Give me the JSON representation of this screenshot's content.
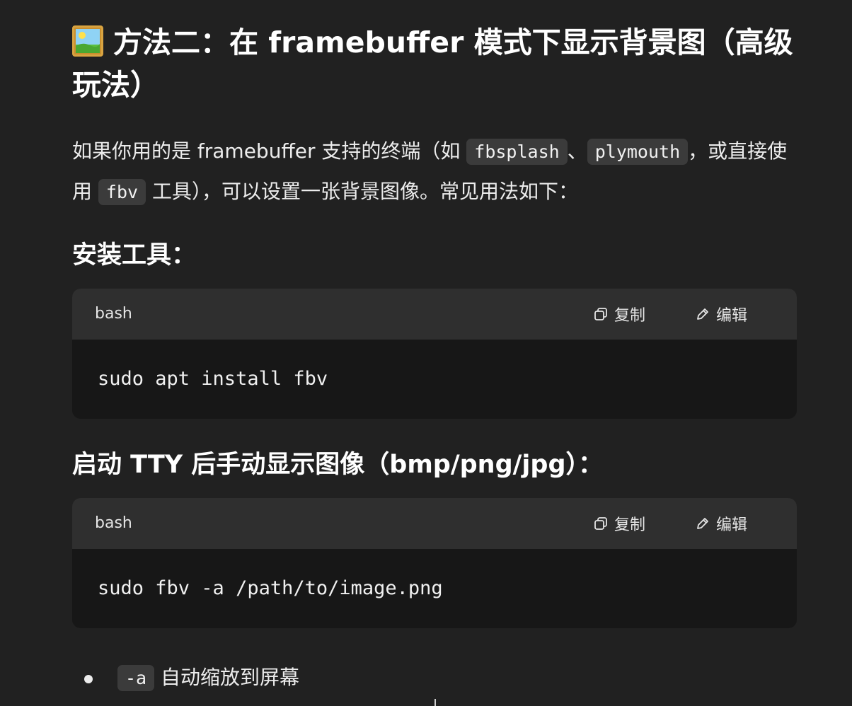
{
  "heading": {
    "icon": "framed-picture-icon",
    "text": "方法二：在 framebuffer 模式下显示背景图（高级玩法）"
  },
  "intro": {
    "part1": "如果你用的是 framebuffer 支持的终端（如 ",
    "code1": "fbsplash",
    "sep1": "、",
    "code2": "plymouth",
    "part2": "，或直接使用 ",
    "code3": "fbv",
    "part3": " 工具），可以设置一张背景图像。常见用法如下："
  },
  "install": {
    "title": "安装工具：",
    "lang": "bash",
    "copy_label": "复制",
    "edit_label": "编辑",
    "code": "sudo apt install fbv"
  },
  "display": {
    "title": "启动 TTY 后手动显示图像（bmp/png/jpg）：",
    "lang": "bash",
    "copy_label": "复制",
    "edit_label": "编辑",
    "code": "sudo fbv -a /path/to/image.png"
  },
  "bullets": [
    {
      "code": "-a",
      "text": " 自动缩放到屏幕"
    }
  ],
  "colors": {
    "background": "#212121",
    "code_header": "#2f2f2f",
    "code_body": "#171717",
    "inline_code_bg": "#3b3b3b"
  }
}
